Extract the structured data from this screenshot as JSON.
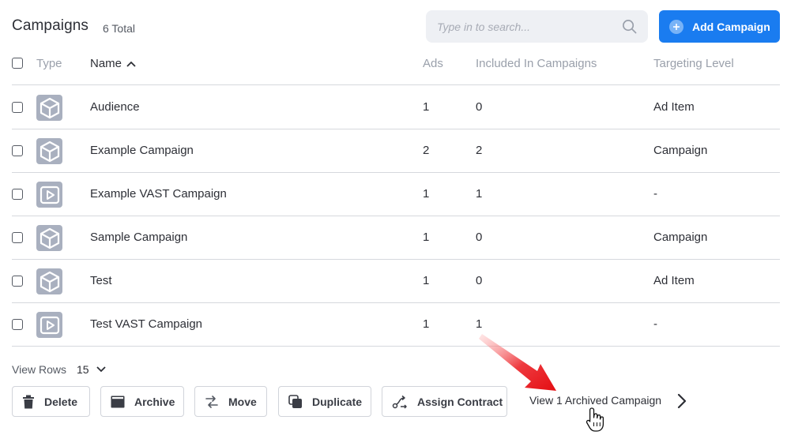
{
  "header": {
    "title": "Campaigns",
    "total": "6 Total",
    "search_placeholder": "Type in to search...",
    "add_button": "Add Campaign"
  },
  "columns": {
    "type": "Type",
    "name": "Name",
    "ads": "Ads",
    "included": "Included In Campaigns",
    "targeting": "Targeting Level"
  },
  "rows": [
    {
      "icon": "cube-icon",
      "name": "Audience",
      "ads": "1",
      "included": "0",
      "targeting": "Ad Item"
    },
    {
      "icon": "cube-icon",
      "name": "Example Campaign",
      "ads": "2",
      "included": "2",
      "targeting": "Campaign"
    },
    {
      "icon": "video-play-icon",
      "name": "Example VAST Campaign",
      "ads": "1",
      "included": "1",
      "targeting": "-"
    },
    {
      "icon": "cube-icon",
      "name": "Sample Campaign",
      "ads": "1",
      "included": "0",
      "targeting": "Campaign"
    },
    {
      "icon": "cube-icon",
      "name": "Test",
      "ads": "1",
      "included": "0",
      "targeting": "Ad Item"
    },
    {
      "icon": "video-play-icon",
      "name": "Test VAST Campaign",
      "ads": "1",
      "included": "1",
      "targeting": "-"
    }
  ],
  "footer": {
    "view_rows_label": "View Rows",
    "view_rows_value": "15",
    "actions": {
      "delete": "Delete",
      "archive": "Archive",
      "move": "Move",
      "duplicate": "Duplicate",
      "assign_contract": "Assign Contract"
    },
    "archived_link": "View 1 Archived Campaign"
  },
  "colors": {
    "accent": "#1a7cf0",
    "icon_bg": "#a9b0bf",
    "annotation_arrow": "#e8141a"
  }
}
